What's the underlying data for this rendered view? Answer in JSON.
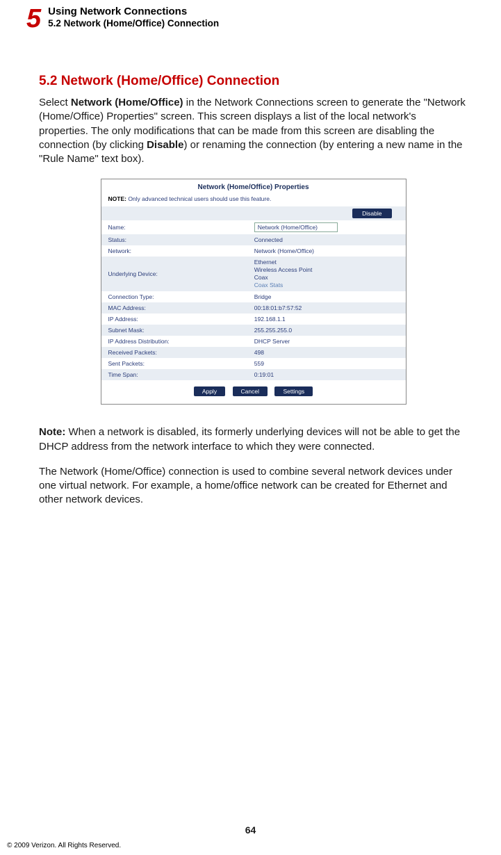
{
  "header": {
    "chapter_number": "5",
    "chapter_title": "Using Network Connections",
    "chapter_subtitle": "5.2  Network (Home/Office) Connection"
  },
  "section": {
    "heading": "5.2  Network (Home/Office) Connection",
    "p1_pre": "Select ",
    "p1_b1": "Network (Home/Office)",
    "p1_mid": " in the Network Connections screen to generate the \"Network (Home/Office) Properties\" screen. This screen displays a list of the local network's properties. The only modifications that can be made from this screen are disabling the connection (by clicking ",
    "p1_b2": "Disable",
    "p1_post": ") or renaming the connection (by entering a new name in the \"Rule Name\" text box).",
    "note_label": "Note:",
    "note_text": " When a network is disabled, its formerly underlying devices will not be able to get the DHCP address from the network interface to which they were connected.",
    "p2": "The Network (Home/Office) connection is used to combine several network devices under one virtual network. For example, a home/office network can be created for Ethernet and other network devices."
  },
  "screenshot": {
    "title": "Network (Home/Office) Properties",
    "note_label": "NOTE:",
    "note_text": " Only advanced technical users should use this feature.",
    "disable_btn": "Disable",
    "rows": {
      "name": {
        "label": "Name:",
        "value": "Network (Home/Office)"
      },
      "status": {
        "label": "Status:",
        "value": "Connected"
      },
      "network": {
        "label": "Network:",
        "value": "Network (Home/Office)"
      },
      "underlying": {
        "label": "Underlying Device:",
        "v1": "Ethernet",
        "v2": "Wireless Access Point",
        "v3": "Coax",
        "v4": "Coax Stats"
      },
      "conn_type": {
        "label": "Connection Type:",
        "value": "Bridge"
      },
      "mac": {
        "label": "MAC Address:",
        "value": "00:18:01:b7:57:52"
      },
      "ip": {
        "label": "IP Address:",
        "value": "192.168.1.1"
      },
      "subnet": {
        "label": "Subnet Mask:",
        "value": "255.255.255.0"
      },
      "dist": {
        "label": "IP Address Distribution:",
        "value": "DHCP Server"
      },
      "rx": {
        "label": "Received Packets:",
        "value": "498"
      },
      "tx": {
        "label": "Sent Packets:",
        "value": "559"
      },
      "time": {
        "label": "Time Span:",
        "value": "0:19:01"
      }
    },
    "actions": {
      "apply": "Apply",
      "cancel": "Cancel",
      "settings": "Settings"
    }
  },
  "footer": {
    "page": "64",
    "copyright": "© 2009 Verizon. All Rights Reserved."
  }
}
